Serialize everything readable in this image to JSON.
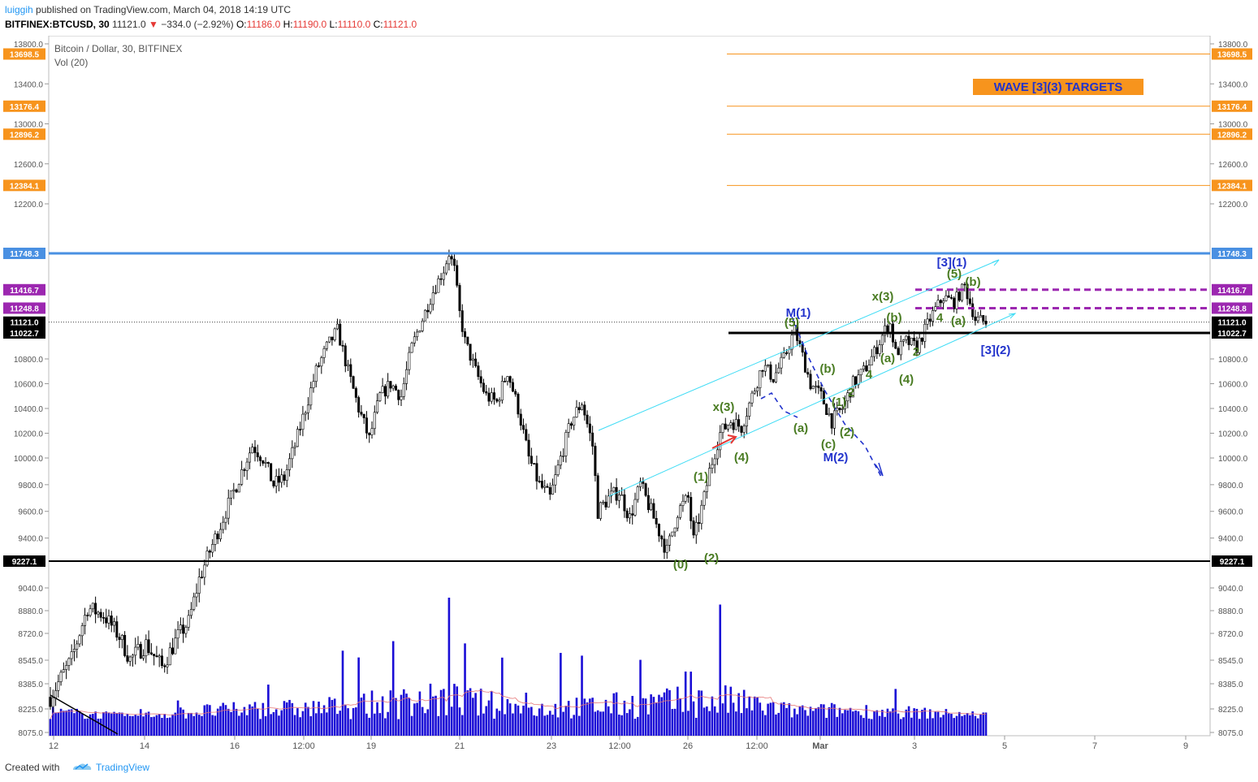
{
  "header": {
    "user": "luiggih",
    "published_text": "published on TradingView.com, March 04, 2018 14:19 UTC",
    "symbol": "BITFINEX:BTCUSD, 30",
    "last": "11121.0",
    "change": "−334.0 (−2.92%)",
    "o_label": "O:",
    "o_value": "11186.0",
    "h_label": "H:",
    "h_value": "11190.0",
    "l_label": "L:",
    "l_value": "11110.0",
    "c_label": "C:",
    "c_value": "11121.0",
    "pane_title": "Bitcoin / Dollar, 30, BITFINEX",
    "vol_label": "Vol (20)"
  },
  "footer": {
    "created": "Created with",
    "brand": "TradingView"
  },
  "colors": {
    "candle": "#000000",
    "volume": "#1a0dd6",
    "vol_ma": "#e57373",
    "target": "#f7941d",
    "resistance": "#4a90e2",
    "purple": "#9c27b0",
    "channel": "#3fdcf5",
    "label_green": "#4a7c23",
    "label_blue": "#2233cc",
    "red_arrow": "#e53935"
  },
  "chart_data": {
    "type": "candlestick",
    "title": "Bitcoin / Dollar, 30, BITFINEX",
    "ylim": [
      8075,
      13800
    ],
    "y_ticks": [
      13800.0,
      13400.0,
      13000.0,
      12600.0,
      12200.0,
      10800.0,
      10600.0,
      10400.0,
      10200.0,
      10000.0,
      9800.0,
      9600.0,
      9400.0,
      9040.0,
      8880.0,
      8720.0,
      8545.0,
      8385.0,
      8225.0,
      8075.0
    ],
    "x_ticks": [
      "12",
      "14",
      "16",
      "12:00",
      "19",
      "21",
      "23",
      "12:00",
      "26",
      "12:00",
      "Mar",
      "3",
      "5",
      "7",
      "9"
    ],
    "price_path": [
      [
        0,
        8300
      ],
      [
        8,
        8550
      ],
      [
        14,
        8900
      ],
      [
        20,
        8850
      ],
      [
        26,
        8700
      ],
      [
        30,
        8550
      ],
      [
        36,
        8650
      ],
      [
        42,
        8500
      ],
      [
        48,
        8700
      ],
      [
        52,
        8800
      ],
      [
        56,
        9100
      ],
      [
        60,
        9300
      ],
      [
        66,
        9600
      ],
      [
        72,
        9900
      ],
      [
        76,
        10100
      ],
      [
        80,
        10000
      ],
      [
        84,
        9800
      ],
      [
        88,
        9850
      ],
      [
        92,
        10100
      ],
      [
        96,
        10400
      ],
      [
        100,
        10700
      ],
      [
        104,
        10900
      ],
      [
        108,
        11050
      ],
      [
        112,
        10700
      ],
      [
        116,
        10400
      ],
      [
        120,
        10150
      ],
      [
        124,
        10500
      ],
      [
        128,
        10600
      ],
      [
        132,
        10500
      ],
      [
        136,
        10900
      ],
      [
        140,
        11150
      ],
      [
        144,
        11400
      ],
      [
        148,
        11600
      ],
      [
        150,
        11750
      ],
      [
        152,
        11600
      ],
      [
        154,
        11200
      ],
      [
        156,
        10950
      ],
      [
        160,
        10700
      ],
      [
        164,
        10500
      ],
      [
        168,
        10450
      ],
      [
        172,
        10700
      ],
      [
        176,
        10400
      ],
      [
        180,
        10000
      ],
      [
        184,
        9800
      ],
      [
        188,
        9700
      ],
      [
        192,
        10000
      ],
      [
        196,
        10300
      ],
      [
        200,
        10450
      ],
      [
        204,
        10100
      ],
      [
        206,
        9600
      ],
      [
        210,
        9700
      ],
      [
        214,
        9750
      ],
      [
        218,
        9550
      ],
      [
        222,
        9800
      ],
      [
        226,
        9600
      ],
      [
        230,
        9400
      ],
      [
        232,
        9300
      ],
      [
        236,
        9600
      ],
      [
        240,
        9700
      ],
      [
        242,
        9380
      ],
      [
        246,
        9700
      ],
      [
        248,
        9900
      ],
      [
        252,
        10200
      ],
      [
        256,
        10300
      ],
      [
        260,
        10250
      ],
      [
        264,
        10500
      ],
      [
        268,
        10750
      ],
      [
        272,
        10650
      ],
      [
        276,
        10800
      ],
      [
        280,
        11050
      ],
      [
        282,
        10900
      ],
      [
        286,
        10600
      ],
      [
        290,
        10500
      ],
      [
        294,
        10300
      ],
      [
        298,
        10400
      ],
      [
        302,
        10600
      ],
      [
        306,
        10700
      ],
      [
        310,
        10850
      ],
      [
        314,
        11050
      ],
      [
        316,
        11100
      ],
      [
        318,
        10850
      ],
      [
        322,
        10950
      ],
      [
        326,
        10900
      ],
      [
        328,
        11000
      ],
      [
        332,
        11200
      ],
      [
        336,
        11350
      ],
      [
        340,
        11300
      ],
      [
        344,
        11450
      ],
      [
        346,
        11300
      ],
      [
        348,
        11150
      ],
      [
        352,
        11121
      ]
    ],
    "volume_profile": [
      {
        "x": 0,
        "v": 0.35
      },
      {
        "x": 30,
        "v": 0.15
      },
      {
        "x": 56,
        "v": 0.4
      },
      {
        "x": 100,
        "v": 0.55
      },
      {
        "x": 150,
        "v": 1.0
      },
      {
        "x": 180,
        "v": 0.5
      },
      {
        "x": 252,
        "v": 0.95
      },
      {
        "x": 280,
        "v": 0.4
      },
      {
        "x": 300,
        "v": 0.45
      },
      {
        "x": 352,
        "v": 0.2
      }
    ],
    "levels": [
      {
        "value": 13698.5,
        "label": "13698.5",
        "type": "target"
      },
      {
        "value": 13176.4,
        "label": "13176.4",
        "type": "target"
      },
      {
        "value": 12896.2,
        "label": "12896.2",
        "type": "target"
      },
      {
        "value": 12384.1,
        "label": "12384.1",
        "type": "target"
      },
      {
        "value": 11748.3,
        "label": "11748.3",
        "type": "resistance"
      },
      {
        "value": 11416.7,
        "label": "11416.7",
        "type": "purple"
      },
      {
        "value": 11248.8,
        "label": "11248.8",
        "type": "purple"
      },
      {
        "value": 11121.0,
        "label": "11121.0",
        "type": "last"
      },
      {
        "value": 11022.7,
        "label": "11022.7",
        "type": "black"
      },
      {
        "value": 9227.1,
        "label": "9227.1",
        "type": "black"
      }
    ],
    "annotations": {
      "targets_title": "WAVE [3](3) TARGETS",
      "waves": [
        "(0)",
        "(2)",
        "(1)",
        "x(3)",
        "(4)",
        "M(1)",
        "(5)",
        "(a)",
        "(b)",
        "(c)",
        "(1)",
        "(2)",
        "M(2)",
        "2",
        "x(3)",
        "(b)",
        "(a)",
        "4",
        "(4)",
        "2",
        "[3](1)",
        "(5)",
        "(b)",
        "4",
        "(a)",
        "[3](2)"
      ]
    }
  }
}
